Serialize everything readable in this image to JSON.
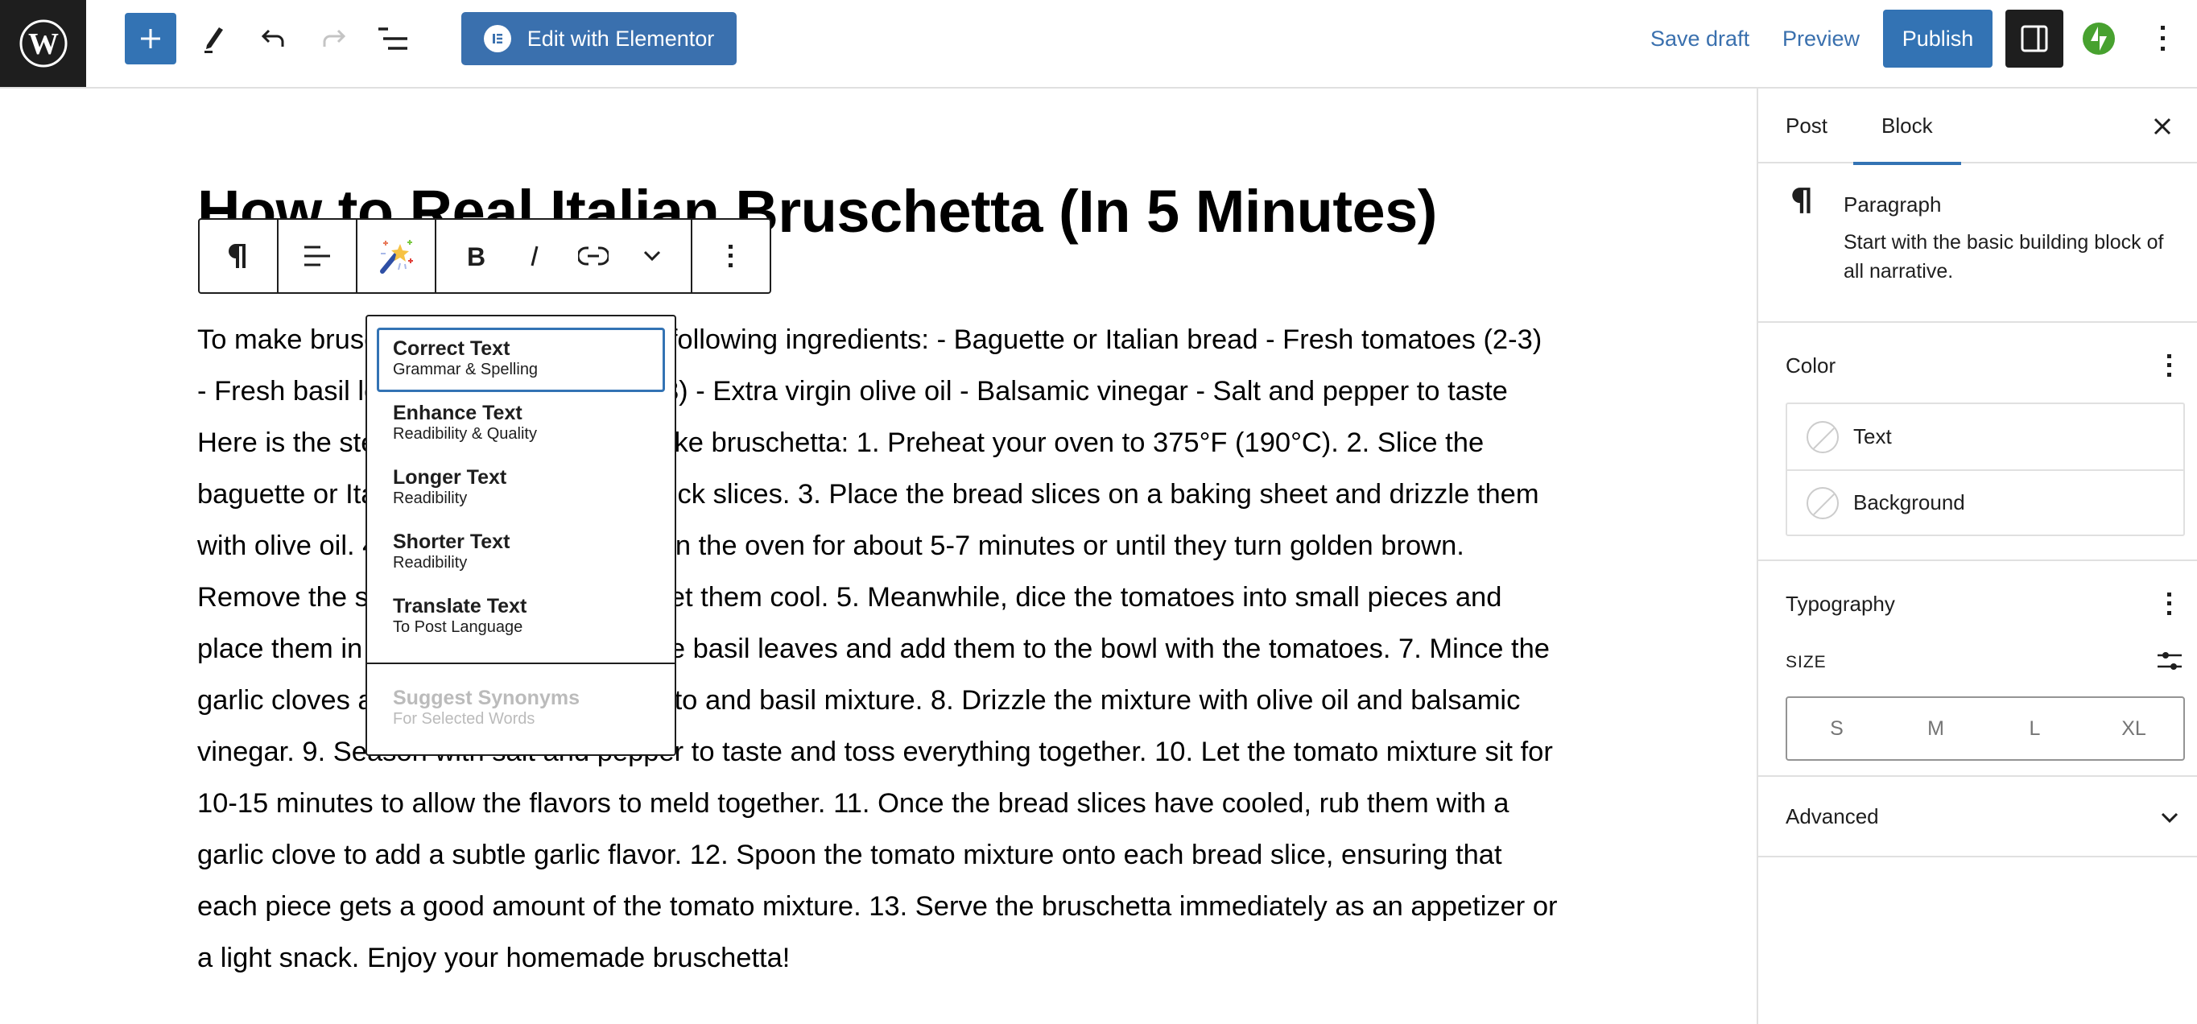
{
  "header": {
    "logo": "wordpress-logo",
    "inserter_label": "Add block",
    "elementor_button": "Edit with Elementor",
    "save_draft": "Save draft",
    "preview": "Preview",
    "publish": "Publish"
  },
  "post": {
    "title": "How to Real Italian Bruschetta (In 5 Minutes)",
    "paragraph": "To make bruschetta, you will need the following ingredients: - Baguette or Italian bread - Fresh tomatoes (2-3) - Fresh basil leaves - Garlic cloves (2-3) - Extra virgin olive oil - Balsamic vinegar - Salt and pepper to taste Here is the step-by-step process to make bruschetta: 1. Preheat your oven to 375°F (190°C). 2. Slice the baguette or Italian bread into ½ inch thick slices. 3. Place the bread slices on a baking sheet and drizzle them with olive oil. 4. Toast the bread slices in the oven for about 5-7 minutes or until they turn golden brown. Remove the slices from the oven and let them cool. 5. Meanwhile, dice the tomatoes into small pieces and place them in a bowl. 6. Finely chop the basil leaves and add them to the bowl with the tomatoes. 7. Mince the garlic cloves and add them to the tomato and basil mixture. 8. Drizzle the mixture with olive oil and balsamic vinegar. 9. Season with salt and pepper to taste and toss everything together. 10. Let the tomato mixture sit for 10-15 minutes to allow the flavors to meld together. 11. Once the bread slices have cooled, rub them with a garlic clove to add a subtle garlic flavor. 12. Spoon the tomato mixture onto each bread slice, ensuring that each piece gets a good amount of the tomato mixture. 13. Serve the bruschetta immediately as an appetizer or a light snack. Enjoy your homemade bruschetta!"
  },
  "block_toolbar": {
    "buttons": [
      "paragraph-transform",
      "align",
      "ai-assistant",
      "bold",
      "italic",
      "link",
      "more-formatting",
      "options"
    ]
  },
  "ai_menu": {
    "items": [
      {
        "title": "Correct Text",
        "subtitle": "Grammar & Spelling",
        "state": "selected"
      },
      {
        "title": "Enhance Text",
        "subtitle": "Readibility & Quality",
        "state": "enabled"
      },
      {
        "title": "Longer Text",
        "subtitle": "Readibility",
        "state": "enabled"
      },
      {
        "title": "Shorter Text",
        "subtitle": "Readibility",
        "state": "enabled"
      },
      {
        "title": "Translate Text",
        "subtitle": "To Post Language",
        "state": "enabled"
      },
      {
        "title": "Suggest Synonyms",
        "subtitle": "For Selected Words",
        "state": "disabled"
      }
    ]
  },
  "sidebar": {
    "tabs": [
      {
        "label": "Post",
        "active": false
      },
      {
        "label": "Block",
        "active": true
      }
    ],
    "block": {
      "name": "Paragraph",
      "description": "Start with the basic building block of all narrative."
    },
    "color": {
      "title": "Color",
      "items": [
        {
          "label": "Text"
        },
        {
          "label": "Background"
        }
      ]
    },
    "typography": {
      "title": "Typography",
      "size_label": "SIZE",
      "sizes": [
        "S",
        "M",
        "L",
        "XL"
      ]
    },
    "advanced": {
      "title": "Advanced"
    }
  },
  "colors": {
    "accent": "#3373b4",
    "elementor": "#3a70ae",
    "jetpack": "#47a12f",
    "dark": "#1e1e1e"
  }
}
